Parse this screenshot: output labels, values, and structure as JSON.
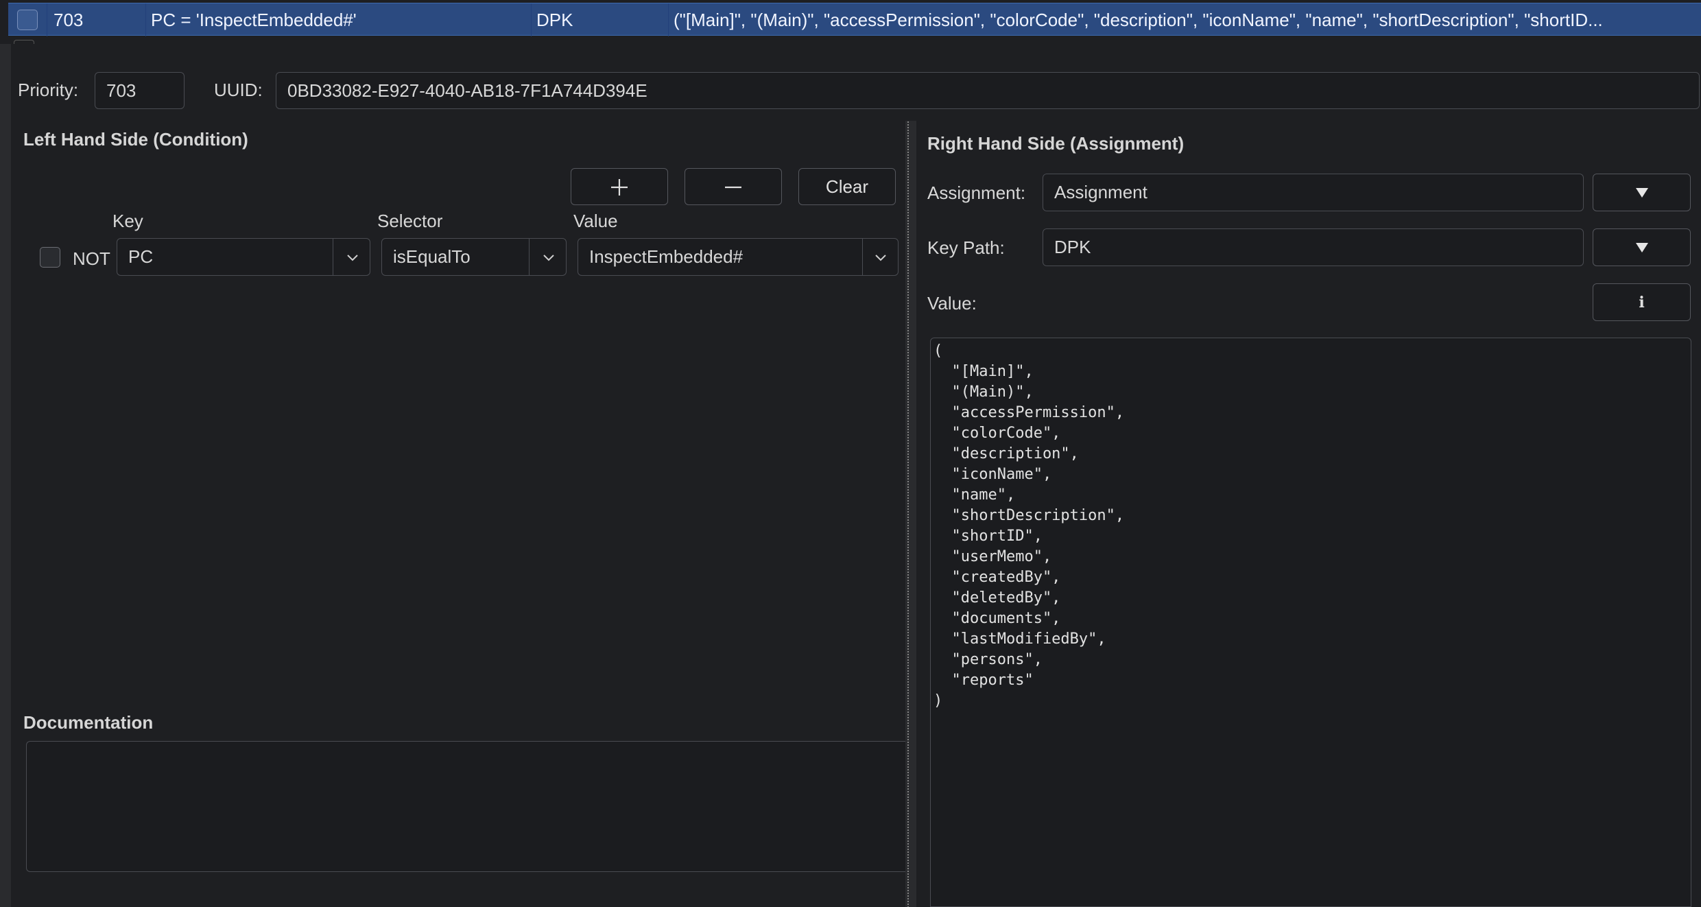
{
  "table_row": {
    "priority": "703",
    "condition": "PC = 'InspectEmbedded#'",
    "key_path": "DPK",
    "value_summary": "(\"[Main]\", \"(Main)\", \"accessPermission\", \"colorCode\", \"description\", \"iconName\", \"name\", \"shortDescription\", \"shortID..."
  },
  "details": {
    "priority_label": "Priority:",
    "priority_value": "703",
    "uuid_label": "UUID:",
    "uuid_value": "0BD33082-E927-4040-AB18-7F1A744D394E"
  },
  "lhs": {
    "title": "Left Hand Side (Condition)",
    "add_label": "+",
    "remove_label": "—",
    "clear_label": "Clear",
    "key_header": "Key",
    "selector_header": "Selector",
    "value_header": "Value",
    "not_label": "NOT",
    "key_value": "PC",
    "selector_value": "isEqualTo",
    "value_value": "InspectEmbedded#"
  },
  "documentation": {
    "title": "Documentation",
    "text": ""
  },
  "rhs": {
    "title": "Right Hand Side (Assignment)",
    "assignment_label": "Assignment:",
    "assignment_value": "Assignment",
    "key_path_label": "Key Path:",
    "key_path_value": "DPK",
    "value_label": "Value:",
    "info_label": "i",
    "value_text": "(\n  \"[Main]\",\n  \"(Main)\",\n  \"accessPermission\",\n  \"colorCode\",\n  \"description\",\n  \"iconName\",\n  \"name\",\n  \"shortDescription\",\n  \"shortID\",\n  \"userMemo\",\n  \"createdBy\",\n  \"deletedBy\",\n  \"documents\",\n  \"lastModifiedBy\",\n  \"persons\",\n  \"reports\"\n)"
  },
  "icons": {
    "dropdown_arrow": "triangle-down-icon",
    "chevron": "chevron-down-icon",
    "info": "info-icon"
  },
  "colors": {
    "selection": "#2b4a80",
    "background": "#1e1f22",
    "field": "#1b1c1f"
  }
}
